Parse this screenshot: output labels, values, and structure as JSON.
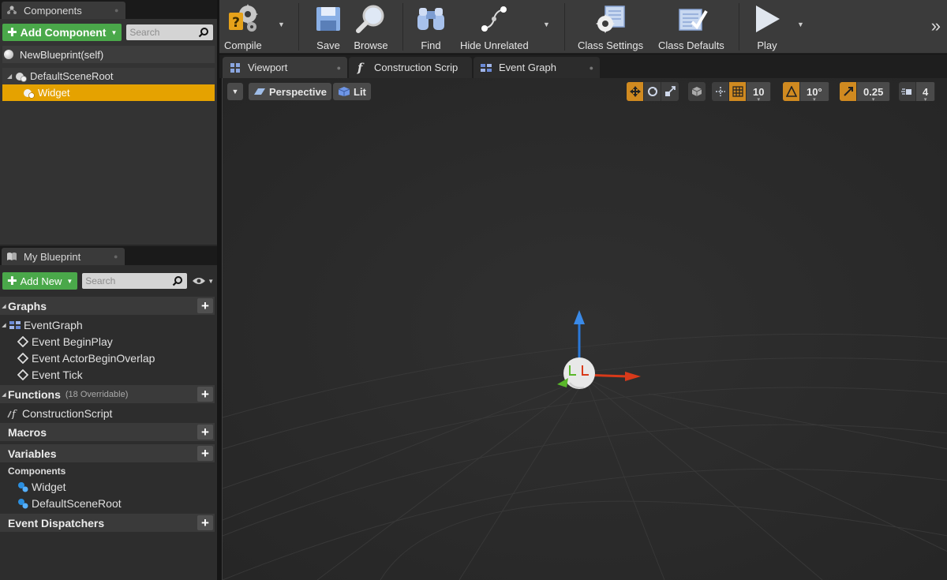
{
  "components_panel": {
    "tab_label": "Components",
    "add_button_label": "Add Component",
    "search_placeholder": "Search",
    "self_label": "NewBlueprint(self)",
    "tree": [
      {
        "label": "DefaultSceneRoot",
        "selected": false
      },
      {
        "label": "Widget",
        "selected": true
      }
    ]
  },
  "myblueprint_panel": {
    "tab_label": "My Blueprint",
    "add_button_label": "Add New",
    "search_placeholder": "Search",
    "sections": {
      "graphs": "Graphs",
      "functions": "Functions",
      "functions_sub": "(18 Overridable)",
      "macros": "Macros",
      "variables": "Variables",
      "event_dispatchers": "Event Dispatchers"
    },
    "graph_items": {
      "event_graph": "EventGraph",
      "events": [
        "Event BeginPlay",
        "Event ActorBeginOverlap",
        "Event Tick"
      ]
    },
    "function_items": [
      "ConstructionScript"
    ],
    "variables_category": "Components",
    "variable_items": [
      "Widget",
      "DefaultSceneRoot"
    ]
  },
  "toolbar": {
    "compile": "Compile",
    "save": "Save",
    "browse": "Browse",
    "find": "Find",
    "hide_unrelated": "Hide Unrelated",
    "class_settings": "Class Settings",
    "class_defaults": "Class Defaults",
    "play": "Play"
  },
  "tabs": {
    "viewport": "Viewport",
    "construction": "Construction Scrip",
    "event_graph": "Event Graph"
  },
  "viewport_toolbar": {
    "perspective": "Perspective",
    "lit": "Lit",
    "grid_snap": "10",
    "rotation_snap": "10°",
    "scale_snap": "0.25",
    "camera_speed": "4"
  },
  "colors": {
    "accent_orange": "#e5a200",
    "add_green": "#4aa84a",
    "gizmo_x": "#d83a1a",
    "gizmo_y": "#5ab82a",
    "gizmo_z": "#2a78d8"
  }
}
